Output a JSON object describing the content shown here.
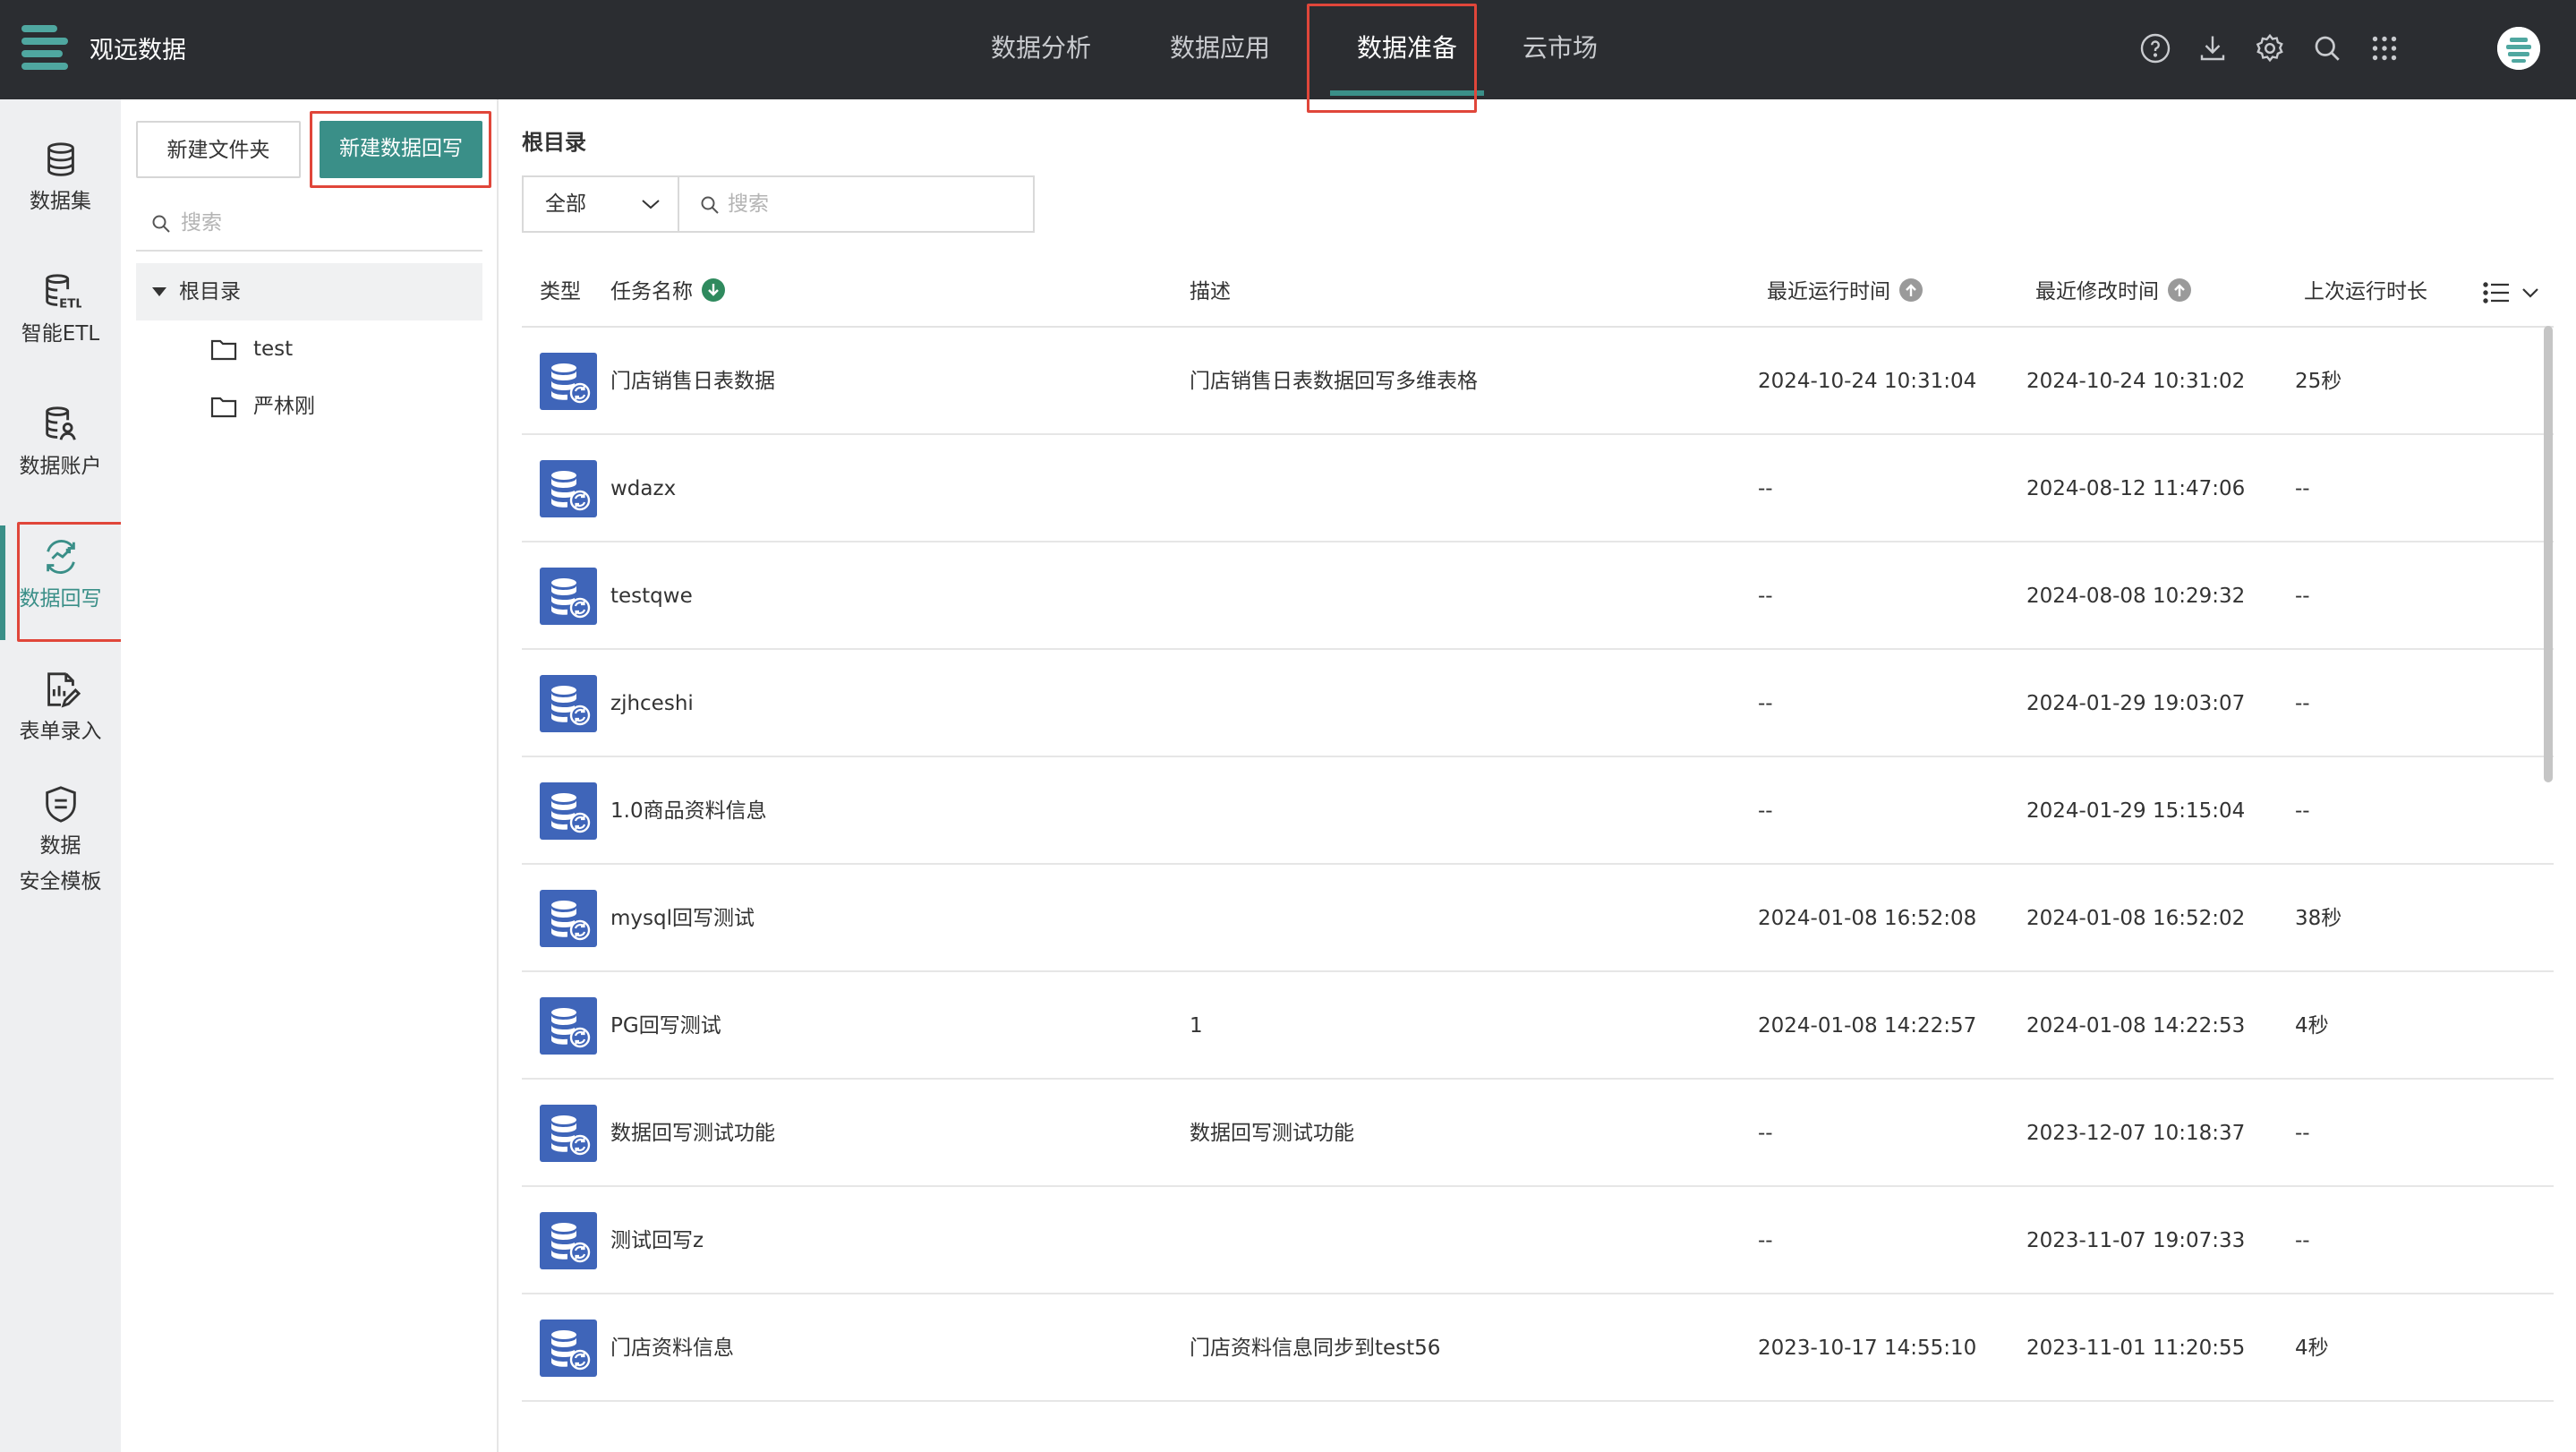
{
  "app": {
    "title": "观远数据"
  },
  "topnav": {
    "items": [
      {
        "label": "数据分析"
      },
      {
        "label": "数据应用"
      },
      {
        "label": "数据准备",
        "active": true
      },
      {
        "label": "云市场"
      }
    ]
  },
  "top_icons": [
    "help-icon",
    "download-icon",
    "settings-icon",
    "search-icon",
    "apps-grid-icon",
    "avatar"
  ],
  "rail": {
    "items": [
      {
        "label": "数据集",
        "icon": "database-icon"
      },
      {
        "label": "智能ETL",
        "icon": "etl-icon"
      },
      {
        "label": "数据账户",
        "icon": "data-account-icon"
      },
      {
        "label": "数据回写",
        "icon": "writeback-icon",
        "active": true
      },
      {
        "label": "表单录入",
        "icon": "form-entry-icon"
      },
      {
        "label_line1": "数据",
        "label_line2": "安全模板",
        "icon": "security-template-icon"
      }
    ]
  },
  "tree": {
    "new_folder_label": "新建文件夹",
    "new_writeback_label": "新建数据回写",
    "search_placeholder": "搜索",
    "root_label": "根目录",
    "folders": [
      {
        "name": "test"
      },
      {
        "name": "严林刚"
      }
    ]
  },
  "main": {
    "breadcrumb": "根目录",
    "filter_value": "全部",
    "search_placeholder": "搜索",
    "columns": {
      "type": "类型",
      "name": "任务名称",
      "desc": "描述",
      "last_run": "最近运行时间",
      "last_modified": "最近修改时间",
      "duration": "上次运行时长"
    },
    "rows": [
      {
        "name": "门店销售日表数据",
        "desc": "门店销售日表数据回写多维表格",
        "last_run": "2024-10-24 10:31:04",
        "last_modified": "2024-10-24 10:31:02",
        "duration": "25秒"
      },
      {
        "name": "wdazx",
        "desc": "",
        "last_run": "--",
        "last_modified": "2024-08-12 11:47:06",
        "duration": "--"
      },
      {
        "name": "testqwe",
        "desc": "",
        "last_run": "--",
        "last_modified": "2024-08-08 10:29:32",
        "duration": "--"
      },
      {
        "name": "zjhceshi",
        "desc": "",
        "last_run": "--",
        "last_modified": "2024-01-29 19:03:07",
        "duration": "--"
      },
      {
        "name": "1.0商品资料信息",
        "desc": "",
        "last_run": "--",
        "last_modified": "2024-01-29 15:15:04",
        "duration": "--"
      },
      {
        "name": "mysql回写测试",
        "desc": "",
        "last_run": "2024-01-08 16:52:08",
        "last_modified": "2024-01-08 16:52:02",
        "duration": "38秒"
      },
      {
        "name": "PG回写测试",
        "desc": "1",
        "last_run": "2024-01-08 14:22:57",
        "last_modified": "2024-01-08 14:22:53",
        "duration": "4秒"
      },
      {
        "name": "数据回写测试功能",
        "desc": "数据回写测试功能",
        "last_run": "--",
        "last_modified": "2023-12-07 10:18:37",
        "duration": "--"
      },
      {
        "name": "测试回写z",
        "desc": "",
        "last_run": "--",
        "last_modified": "2023-11-07 19:07:33",
        "duration": "--"
      },
      {
        "name": "门店资料信息",
        "desc": "门店资料信息同步到test56",
        "last_run": "2023-10-17 14:55:10",
        "last_modified": "2023-11-01 11:20:55",
        "duration": "4秒"
      }
    ]
  },
  "colors": {
    "accent": "#3a8f88",
    "topbar": "#2b2d31",
    "row_icon": "#3f65b9",
    "highlight": "#e0463a"
  }
}
